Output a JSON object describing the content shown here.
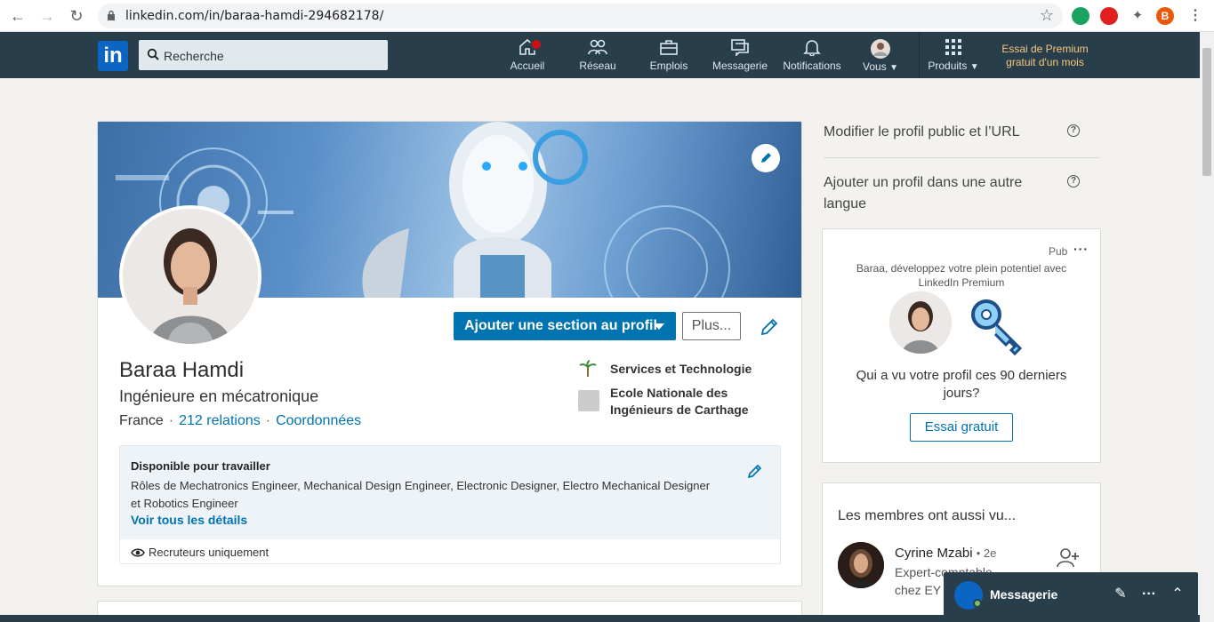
{
  "browser": {
    "url": "linkedin.com/in/baraa-hamdi-294682178/",
    "profile_initial": "B"
  },
  "header": {
    "logo": "in",
    "search_placeholder": "Recherche",
    "nav": [
      {
        "label": "Accueil",
        "icon": "home-icon"
      },
      {
        "label": "Réseau",
        "icon": "network-icon"
      },
      {
        "label": "Emplois",
        "icon": "briefcase-icon"
      },
      {
        "label": "Messagerie",
        "icon": "messaging-icon"
      },
      {
        "label": "Notifications",
        "icon": "bell-icon"
      },
      {
        "label": "Vous",
        "icon": "avatar-icon"
      },
      {
        "label": "Produits",
        "icon": "grid-icon"
      }
    ],
    "premium_cta": "Essai de Premium gratuit d'un mois"
  },
  "profile": {
    "name": "Baraa Hamdi",
    "headline": "Ingénieure en mécatronique",
    "location": "France",
    "relations": "212 relations",
    "contact": "Coordonnées",
    "add_section": "Ajouter une section au profil",
    "more": "Plus...",
    "company": "Services et Technologie",
    "school": "Ecole Nationale des Ingénieurs de Carthage"
  },
  "open_to_work": {
    "title": "Disponible pour travailler",
    "description": "Rôles de Mechatronics Engineer, Mechanical Design Engineer, Electronic Designer, Electro Mechanical Designer et Robotics Engineer",
    "link": "Voir tous les détails",
    "visibility": "Recruteurs uniquement"
  },
  "right_rail": {
    "edit_public": "Modifier le profil public et l’URL",
    "add_language": "Ajouter un profil dans une autre langue",
    "ad": {
      "tag": "Pub",
      "text": "Baraa, développez votre plein potentiel avec LinkedIn Premium",
      "question": "Qui a vu votre profil ces 90 derniers jours?",
      "button": "Essai gratuit"
    },
    "also_viewed": {
      "title": "Les membres ont aussi vu...",
      "name": "Cyrine Mzabi",
      "degree": "• 2e",
      "subtitle": "Expert-comptable chez EY"
    }
  },
  "messaging": {
    "title": "Messagerie"
  },
  "colors": {
    "header_bg": "#283e4a",
    "primary": "#0073b1",
    "page_bg": "#f3f2ef",
    "premium": "#f8c77e"
  }
}
